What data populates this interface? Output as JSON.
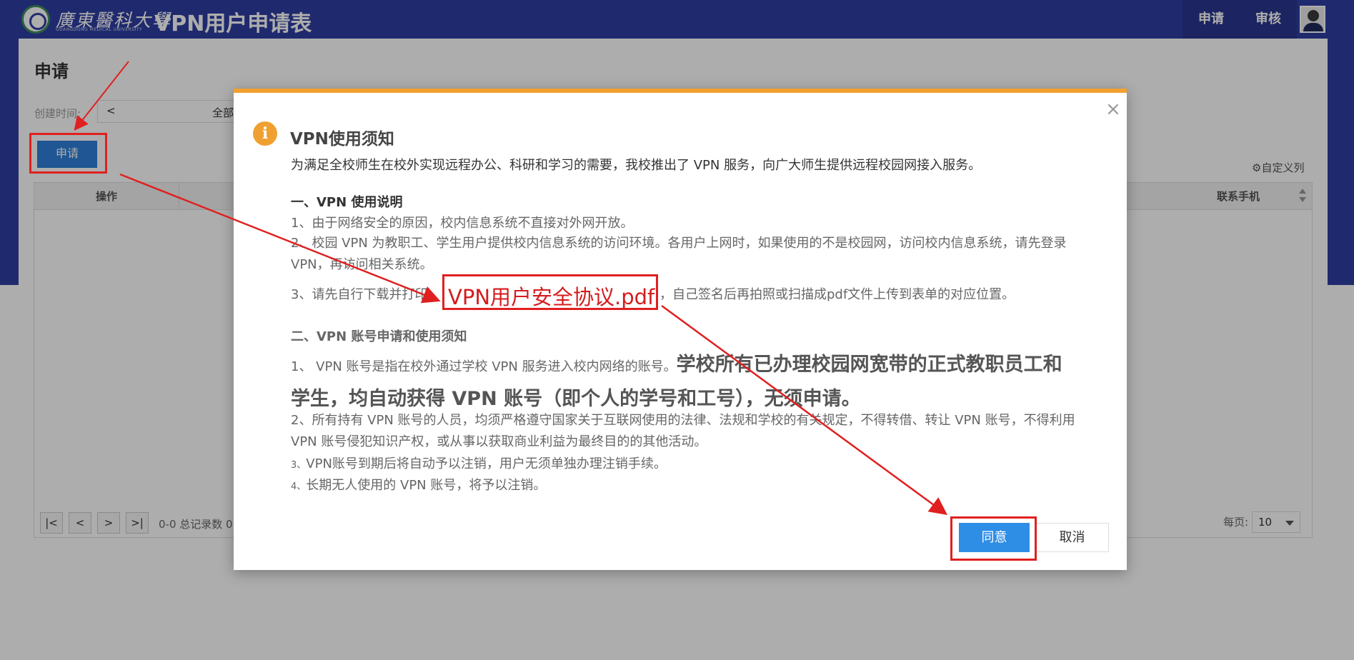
{
  "header": {
    "logo_cn": "廣東醫科大學",
    "logo_en": "GUANGDONG MEDICAL UNIVERSITY",
    "app_title": "VPN用户申请表",
    "nav": [
      "申请",
      "审核"
    ]
  },
  "page": {
    "heading": "申请",
    "filter_label": "创建时间:",
    "filter_prev": "<",
    "filter_value": "全部",
    "apply_button": "申请",
    "custom_columns": "自定义列",
    "table": {
      "col_action": "操作",
      "col_phone": "联系手机"
    },
    "pager": {
      "first": "|<",
      "prev": "<",
      "next": ">",
      "last": ">|",
      "summary": "0-0 总记录数 0",
      "per_page_label": "每页:",
      "per_page_value": "10"
    }
  },
  "modal": {
    "title": "VPN使用须知",
    "intro": "为满足全校师生在校外实现远程办公、科研和学习的需要，我校推出了 VPN 服务，向广大师生提供远程校园网接入服务。",
    "section1_heading": "一、VPN 使用说明",
    "s1_item1": "1、由于网络安全的原因，校内信息系统不直接对外网开放。",
    "s1_item2": "2、校园 VPN 为教职工、学生用户提供校内信息系统的访问环境。各用户上网时，如果使用的不是校园网，访问校内信息系统，请先登录 VPN，再访问相关系统。",
    "s1_item3_prefix": "3、请先自行下载并打印",
    "s1_item3_link": "VPN用户安全协议.pdf",
    "s1_item3_suffix": "，自己签名后再拍照或扫描成pdf文件上传到表单的对应位置。",
    "section2_heading": "二、VPN 账号申请和使用须知",
    "s2_item1_normal": "1、 VPN 账号是指在校外通过学校 VPN 服务进入校内网络的账号。",
    "s2_item1_bold": "学校所有已办理校园网宽带的正式教职员工和学生，均自动获得 VPN 账号（即个人的学号和工号），无须申请。",
    "s2_item2": "2、所有持有 VPN 账号的人员，均须严格遵守国家关于互联网使用的法律、法规和学校的有关规定，不得转借、转让 VPN 账号，不得利用 VPN 账号侵犯知识产权，或从事以获取商业利益为最终目的的其他活动。",
    "s2_item3_num": "3、",
    "s2_item3": "VPN账号到期后将自动予以注销，用户无须单独办理注销手续。",
    "s2_item4_num": "4、",
    "s2_item4": "长期无人使用的 VPN 账号，将予以注销。",
    "agree_button": "同意",
    "cancel_button": "取消",
    "close_symbol": "×",
    "info_symbol": "i"
  },
  "colors": {
    "header_blue": "#2f3ea3",
    "accent_orange": "#f0a030",
    "primary_button": "#2e8ee6",
    "annotation_red": "#e02020"
  }
}
